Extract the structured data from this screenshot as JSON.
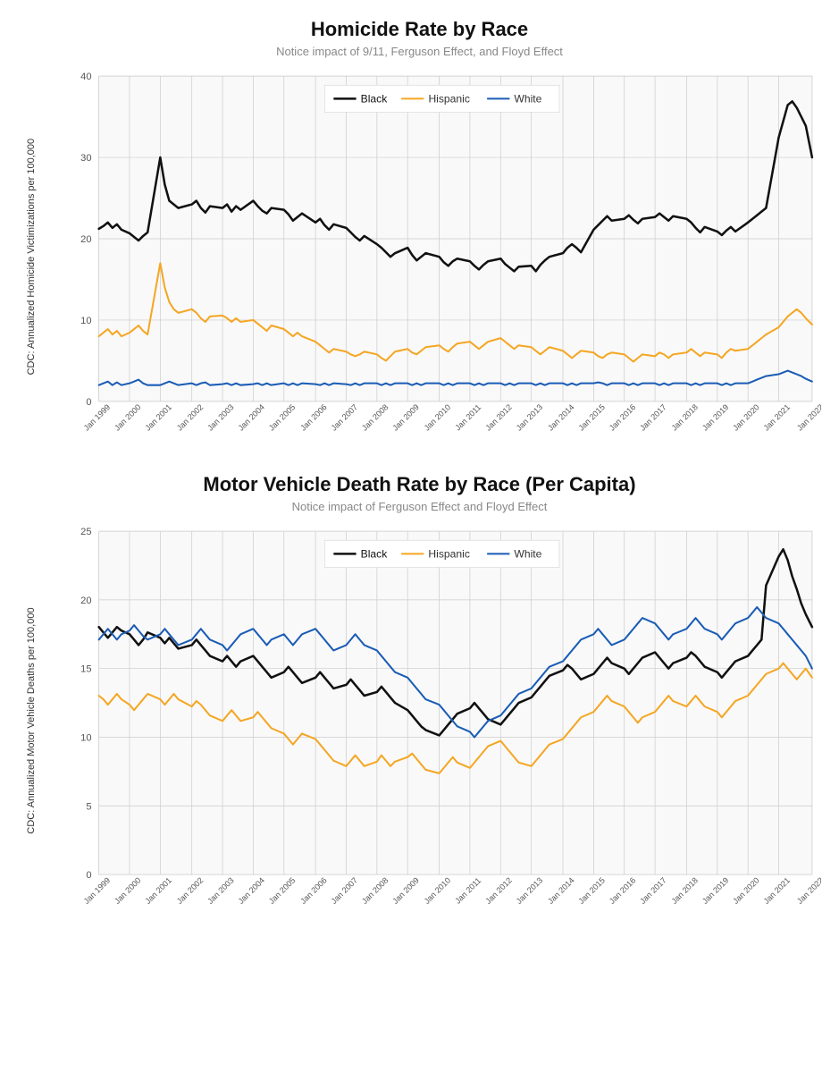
{
  "chart1": {
    "title": "Homicide Rate by Race",
    "subtitle": "Notice impact of 9/11, Ferguson Effect, and Floyd Effect",
    "y_label": "CDC: Annualized Homicide Victimizations per 100,000",
    "legend": [
      {
        "label": "Black",
        "color": "#111",
        "stroke": 2.5
      },
      {
        "label": "Hispanic",
        "color": "#f5a623",
        "stroke": 2
      },
      {
        "label": "White",
        "color": "#1a5cb5",
        "stroke": 2
      }
    ]
  },
  "chart2": {
    "title": "Motor Vehicle Death Rate by Race (Per Capita)",
    "subtitle": "Notice impact of Ferguson Effect and Floyd Effect",
    "y_label": "CDC: Annualized Motor Vehicle Deaths per 100,000",
    "legend": [
      {
        "label": "Black",
        "color": "#111",
        "stroke": 2.5
      },
      {
        "label": "Hispanic",
        "color": "#f5a623",
        "stroke": 2
      },
      {
        "label": "White",
        "color": "#1a5cb5",
        "stroke": 2
      }
    ]
  }
}
